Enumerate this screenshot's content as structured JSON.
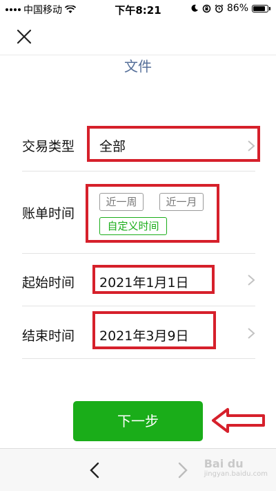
{
  "status_bar": {
    "carrier": "中国移动",
    "time": "下午8:21",
    "battery_percent": "86%",
    "battery_level": 0.86
  },
  "header": {
    "title": "文件",
    "close_icon": "close-icon"
  },
  "form": {
    "transaction_type": {
      "label": "交易类型",
      "value": "全部"
    },
    "bill_time": {
      "label": "账单时间",
      "options": [
        "近一周",
        "近一月",
        "自定义时间"
      ],
      "selected": "自定义时间"
    },
    "start_time": {
      "label": "起始时间",
      "value": "2021年1月1日"
    },
    "end_time": {
      "label": "结束时间",
      "value": "2021年3月9日"
    }
  },
  "actions": {
    "next_label": "下一步"
  },
  "watermark": {
    "text": "Bai du",
    "sub": "jingyan.baidu.com"
  },
  "colors": {
    "accent_green": "#1aad19",
    "annotation_red": "#d6202b",
    "title_blue": "#556f99"
  }
}
